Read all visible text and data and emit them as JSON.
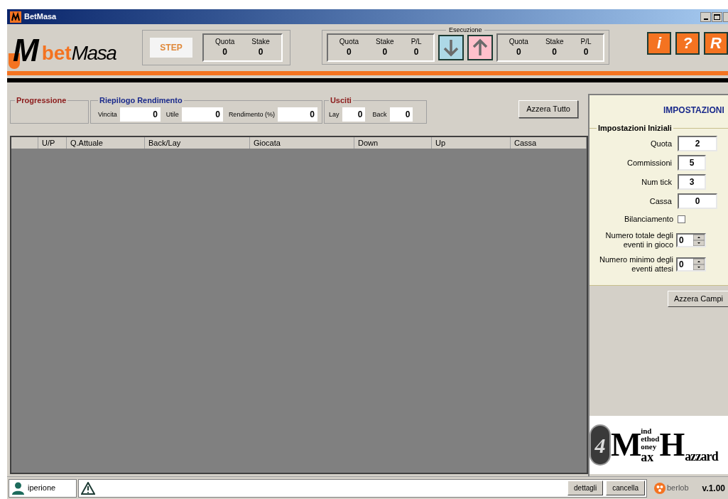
{
  "window": {
    "title": "BetMasa"
  },
  "logo": {
    "letter": "M",
    "part1": "bet",
    "part2": "Masa"
  },
  "step": {
    "label": "STEP",
    "fields": [
      {
        "label": "Quota",
        "value": "0"
      },
      {
        "label": "Stake",
        "value": "0"
      }
    ]
  },
  "esecuzione": {
    "title": "Esecuzione",
    "left": [
      {
        "label": "Quota",
        "value": "0"
      },
      {
        "label": "Stake",
        "value": "0"
      },
      {
        "label": "P/L",
        "value": "0"
      }
    ],
    "buttons": [
      {
        "kind": "down"
      },
      {
        "kind": "up"
      }
    ],
    "right": [
      {
        "label": "Quota",
        "value": "0"
      },
      {
        "label": "Stake",
        "value": "0"
      },
      {
        "label": "P/L",
        "value": "0"
      }
    ]
  },
  "tool_buttons": [
    "i",
    "?",
    "R"
  ],
  "groups": {
    "progressione": {
      "title": "Progressione"
    },
    "riepilogo": {
      "title": "Riepilogo Rendimento",
      "fields": [
        {
          "label": "Vincita",
          "value": "0"
        },
        {
          "label": "Utile",
          "value": "0"
        },
        {
          "label": "Rendimento (%)",
          "value": "0"
        }
      ]
    },
    "usciti": {
      "title": "Usciti",
      "fields": [
        {
          "label": "Lay",
          "value": "0"
        },
        {
          "label": "Back",
          "value": "0"
        }
      ]
    }
  },
  "reset_all_button": "Azzera Tutto",
  "table": {
    "columns": [
      "U/P",
      "Q.Attuale",
      "Back/Lay",
      "Giocata",
      "Down",
      "Up",
      "Cassa"
    ]
  },
  "settings": {
    "title": "IMPOSTAZIONI",
    "group": "Impostazioni Iniziali",
    "fields": [
      {
        "kind": "text",
        "label": "Quota",
        "value": "2",
        "wide": true
      },
      {
        "kind": "text",
        "label": "Commissioni",
        "value": "5",
        "wide": false
      },
      {
        "kind": "text",
        "label": "Num tick",
        "value": "3",
        "wide": false
      },
      {
        "kind": "text",
        "label": "Cassa",
        "value": "0",
        "wide": true
      },
      {
        "kind": "checkbox",
        "label": "Bilanciamento",
        "checked": false
      },
      {
        "kind": "spinner",
        "label": "Numero totale degli eventi in gioco",
        "value": "0"
      },
      {
        "kind": "spinner",
        "label": "Numero minimo degli eventi attesi",
        "value": "0"
      }
    ],
    "reset_button": "Azzera Campi"
  },
  "banner": {
    "number": "4",
    "big1": "M",
    "lines": [
      "ind",
      "ethod",
      "oney"
    ],
    "tail1": "ax",
    "big2": "H",
    "tail2": "azzard"
  },
  "status_bar": {
    "user": "iperione",
    "buttons": [
      "dettagli",
      "cancella"
    ],
    "brand": "berlob",
    "version": "v.1.00"
  }
}
